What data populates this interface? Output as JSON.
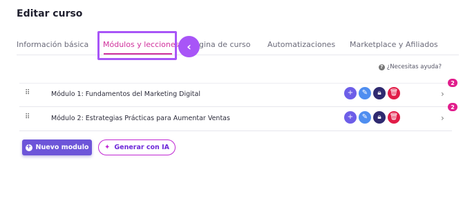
{
  "page": {
    "title": "Editar curso"
  },
  "tabs": [
    {
      "label": "Información básica",
      "active": false
    },
    {
      "label": "Módulos y lecciones",
      "active": true
    },
    {
      "label": "gina de curso",
      "active": false
    },
    {
      "label": "Automatizaciones",
      "active": false
    },
    {
      "label": "Marketplace y Afiliados",
      "active": false
    }
  ],
  "highlight": {
    "arrow_icon": "chevron-left-icon"
  },
  "help": {
    "icon": "question-circle-icon",
    "label": "¿Necesitas ayuda?"
  },
  "modules": [
    {
      "title": "Módulo 1: Fundamentos del Marketing Digital",
      "badge": "2",
      "drag_icon": "drag-handle-icon",
      "actions": [
        "add-icon",
        "edit-icon",
        "lock-icon",
        "trash-icon"
      ],
      "chevron": "chevron-right-icon"
    },
    {
      "title": "Módulo 2: Estrategias Prácticas para Aumentar Ventas",
      "badge": "2",
      "drag_icon": "drag-handle-icon",
      "actions": [
        "add-icon",
        "edit-icon",
        "lock-icon",
        "trash-icon"
      ],
      "chevron": "chevron-right-icon"
    }
  ],
  "buttons": {
    "new_module": "Nuevo modulo",
    "generate_ai": "Generar con IA"
  },
  "colors": {
    "accent_pink": "#d0309c",
    "highlight_purple": "#a855f7",
    "primary_button": "#6d55d9",
    "add": "#6d5ee8",
    "edit": "#4f8ef0",
    "lock": "#2f2a70",
    "delete": "#e11d48",
    "badge": "#e11d8c"
  }
}
